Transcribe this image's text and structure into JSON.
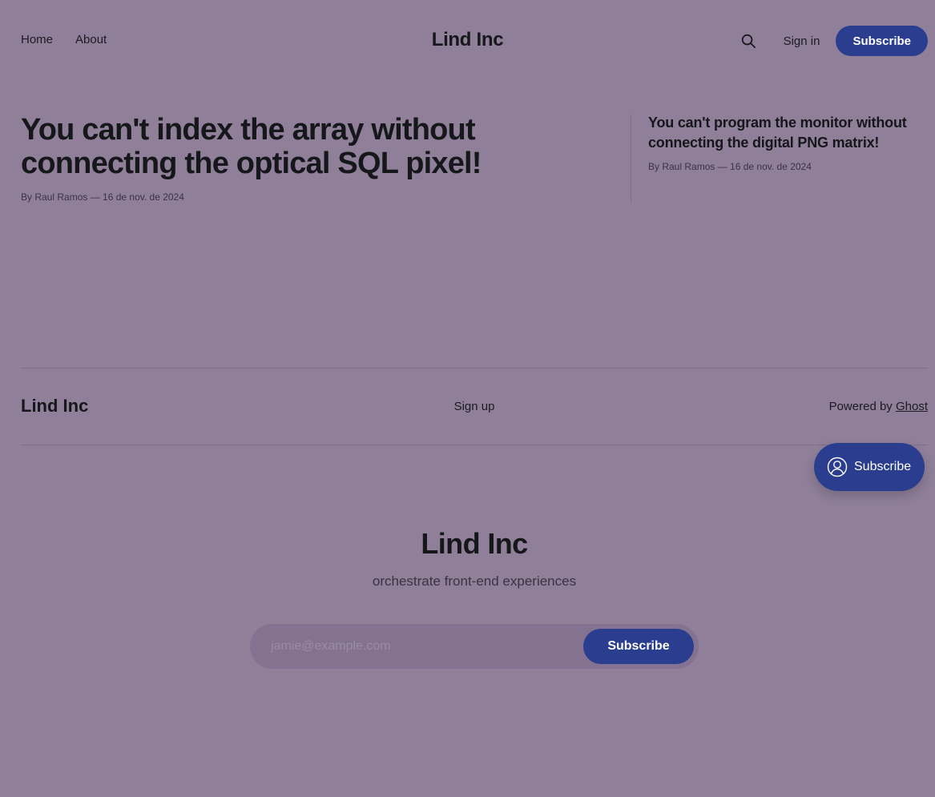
{
  "header": {
    "nav": [
      {
        "label": "Home"
      },
      {
        "label": "About"
      }
    ],
    "site_title": "Lind Inc",
    "search_icon": "search-icon",
    "signin_label": "Sign in",
    "subscribe_label": "Subscribe"
  },
  "featured": {
    "main": {
      "title": "You can't index the array without connecting the optical SQL pixel!",
      "meta": "By Raul Ramos — 16 de nov. de 2024"
    },
    "side": {
      "title": "You can't program the monitor without connecting the digital PNG matrix!",
      "meta": "By Raul Ramos — 16 de nov. de 2024"
    }
  },
  "footer": {
    "site_title": "Lind Inc",
    "signup_label": "Sign up",
    "powered_prefix": "Powered by ",
    "powered_link": "Ghost"
  },
  "portal": {
    "label": "Subscribe",
    "icon": "user-circle-icon"
  },
  "cta": {
    "title": "Lind Inc",
    "subtitle": "orchestrate front-end experiences",
    "email_placeholder": "jamie@example.com",
    "button_label": "Subscribe"
  },
  "colors": {
    "background": "#8f7f99",
    "accent": "#2a3d8f",
    "text": "#15171a"
  }
}
